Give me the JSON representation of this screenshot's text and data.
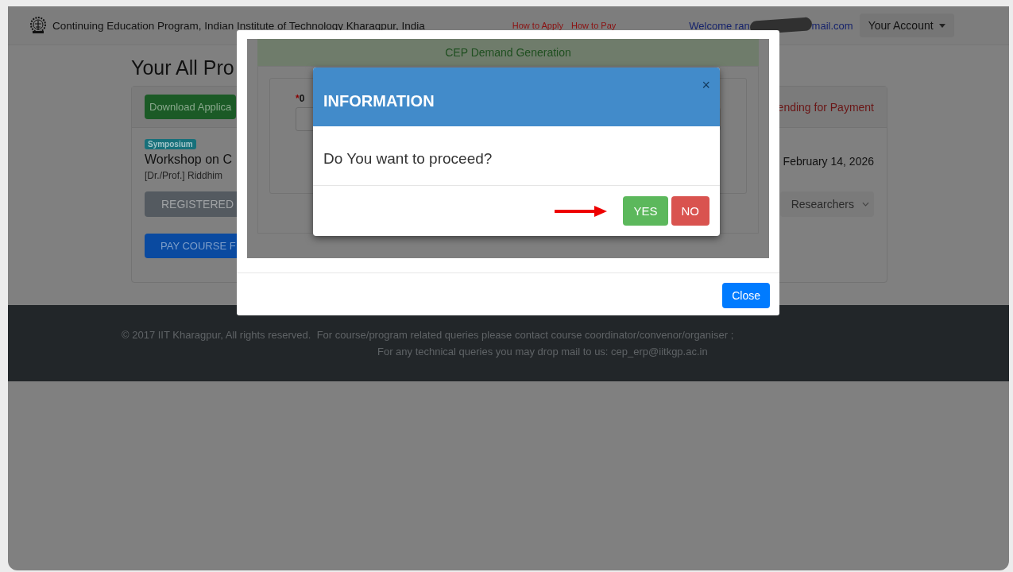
{
  "header": {
    "title": "Continuing Education Program, Indian Institute of Technology Kharagpur, India",
    "links": [
      "How to Apply",
      "How to Pay"
    ],
    "welcome_start": "Welcome ran",
    "welcome_end": "mail.com",
    "account_button": "Your Account"
  },
  "page": {
    "heading": "Your All Pro",
    "card": {
      "download_button": "Download Applica",
      "status": "ending for Payment",
      "badge": "Symposium",
      "title": "Workshop on C",
      "person": "[Dr./Prof.] Riddhim",
      "registered_button": "REGISTERED",
      "pay_button": "PAY COURSE F",
      "date": "February 14, 2026",
      "select": {
        "value": "Researchers"
      }
    }
  },
  "footer": {
    "lines": [
      "© 2017 IIT Kharagpur, All rights reserved.  For course/program related queries please contact course coordinator/convenor/organiser ;",
      "For any technical queries you may drop mail to us: cep_erp@iitkgp.ac.in"
    ]
  },
  "modal": {
    "frame_title": "CEP Demand Generation",
    "required_mark": "*",
    "field_label": "0",
    "close_button": "Close",
    "dialog": {
      "title": "INFORMATION",
      "close_glyph": "×",
      "message": "Do You want to proceed?",
      "buttons": [
        {
          "label": "YES",
          "kind": "confirm"
        },
        {
          "label": "NO",
          "kind": "cancel"
        }
      ]
    }
  }
}
